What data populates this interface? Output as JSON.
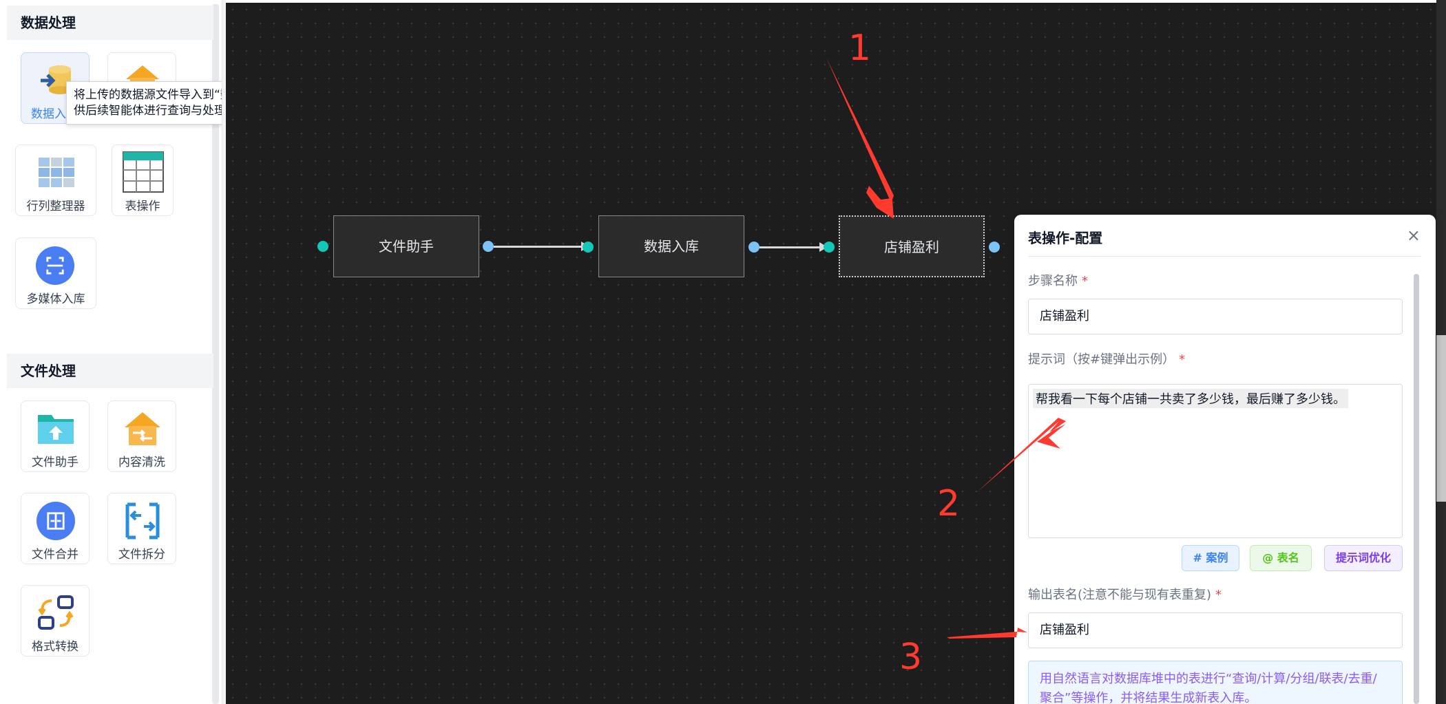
{
  "sidebar": {
    "sections": [
      {
        "title": "数据处理",
        "items": [
          {
            "label": "数据入库",
            "visible_label": "数据入",
            "icon": "database-import-icon"
          },
          {
            "label": "",
            "icon": "house-icon"
          },
          {
            "label": "行列整理器",
            "icon": "grid-icon"
          },
          {
            "label": "表操作",
            "icon": "table-icon"
          },
          {
            "label": "多媒体入库",
            "icon": "scan-icon"
          }
        ]
      },
      {
        "title": "文件处理",
        "items": [
          {
            "label": "文件助手",
            "icon": "folder-upload-icon"
          },
          {
            "label": "内容清洗",
            "icon": "house-clean-icon"
          },
          {
            "label": "文件合并",
            "icon": "merge-icon"
          },
          {
            "label": "文件拆分",
            "icon": "split-icon"
          },
          {
            "label": "格式转换",
            "icon": "convert-icon"
          }
        ]
      }
    ],
    "tooltip": {
      "line1": "将上传的数据源文件导入到“数据库堆”中，",
      "line2": "供后续智能体进行查询与处理。"
    }
  },
  "canvas": {
    "nodes": [
      {
        "label": "文件助手"
      },
      {
        "label": "数据入库"
      },
      {
        "label": "店铺盈利",
        "selected": true
      }
    ]
  },
  "panel": {
    "title": "表操作-配置",
    "close": "×",
    "step_name_label": "步骤名称",
    "step_name_value": "店铺盈利",
    "prompt_label": "提示词（按#键弹出示例）",
    "prompt_value": "帮我看一下每个店铺一共卖了多少钱，最后赚了多少钱。",
    "buttons": {
      "case": "# 案例",
      "table": "@ 表名",
      "optimize": "提示词优化"
    },
    "output_label": "输出表名(注意不能与现有表重复)",
    "output_value": "店铺盈利",
    "info_line1": "用自然语言对数据库堆中的表进行“查询/计算/分组/联表/去重/",
    "info_line2": "聚合”等操作，并将结果生成新表入库。",
    "required_mark": "*"
  },
  "annotations": [
    "1",
    "2",
    "3"
  ],
  "colors": {
    "accent": "#3b82f6",
    "annotation": "#ff3b30",
    "port_in": "#14c7b8",
    "port_out": "#7cc4f8"
  }
}
